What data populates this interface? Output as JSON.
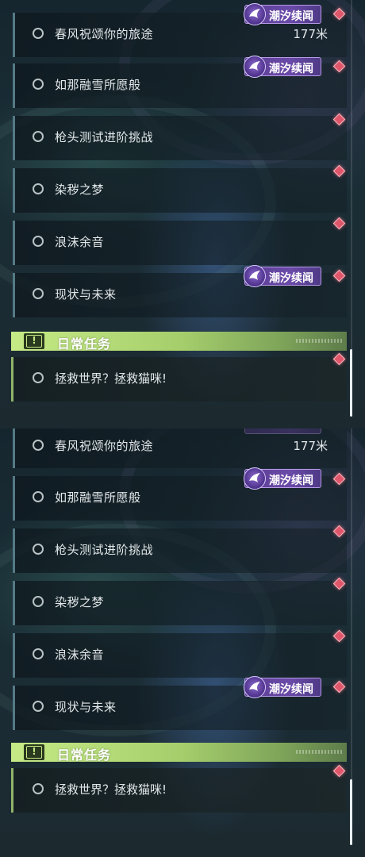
{
  "quests": [
    {
      "title": "春风祝颂你的旅途",
      "distance": "177米"
    },
    {
      "title": "如那融雪所愿般"
    },
    {
      "title": "枪头测试进阶挑战"
    },
    {
      "title": "染秽之梦"
    },
    {
      "title": "浪沫余音"
    },
    {
      "title": "现状与未来"
    }
  ],
  "tag_label": "潮汐续闻",
  "daily_section": {
    "title": "日常任务",
    "icon": "exclamation-icon",
    "quests": [
      {
        "title": "拯救世界？拯救猫咪!"
      }
    ]
  },
  "icons": {
    "quest_marker": "diamond-marker-icon",
    "tag_icon": "tide-emblem-icon",
    "track_state": "radio-circle-icon"
  },
  "colors": {
    "tag_purple": "#6a4aa8",
    "daily_green": "#c5ea86",
    "marker_red": "#e0566a"
  }
}
